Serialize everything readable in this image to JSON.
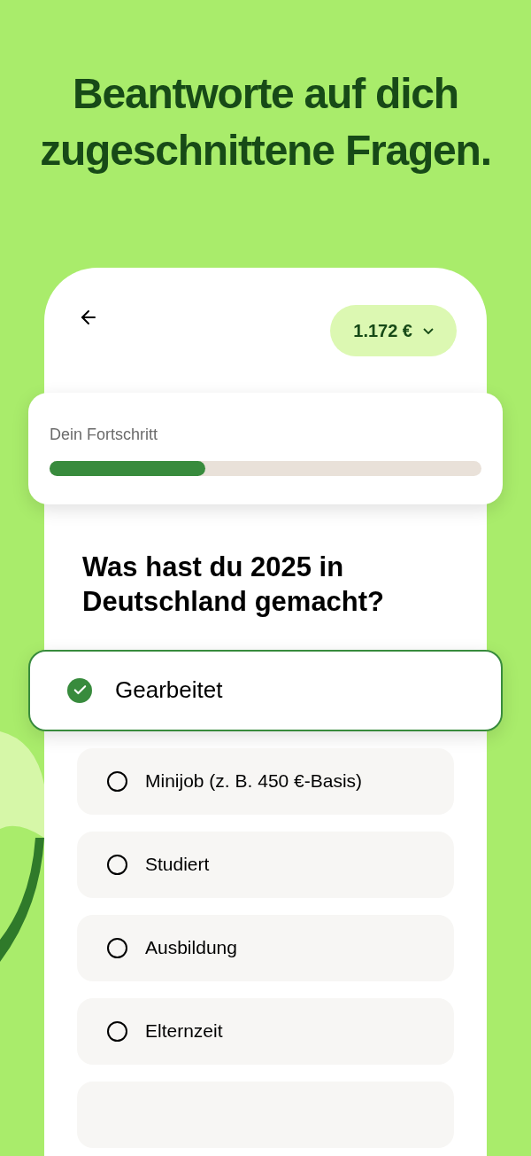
{
  "headline": "Beantworte auf dich zugeschnittene Fragen.",
  "header": {
    "amount": "1.172 €"
  },
  "progress": {
    "label": "Dein Fortschritt",
    "level": 0.36
  },
  "question": "Was hast du 2025 in Deutschland gemacht?",
  "options": [
    {
      "label": "Gearbeitet",
      "selected": true
    },
    {
      "label": "Minijob (z. B. 450 €-Basis)",
      "selected": false
    },
    {
      "label": "Studiert",
      "selected": false
    },
    {
      "label": "Ausbildung",
      "selected": false
    },
    {
      "label": "Elternzeit",
      "selected": false
    }
  ]
}
